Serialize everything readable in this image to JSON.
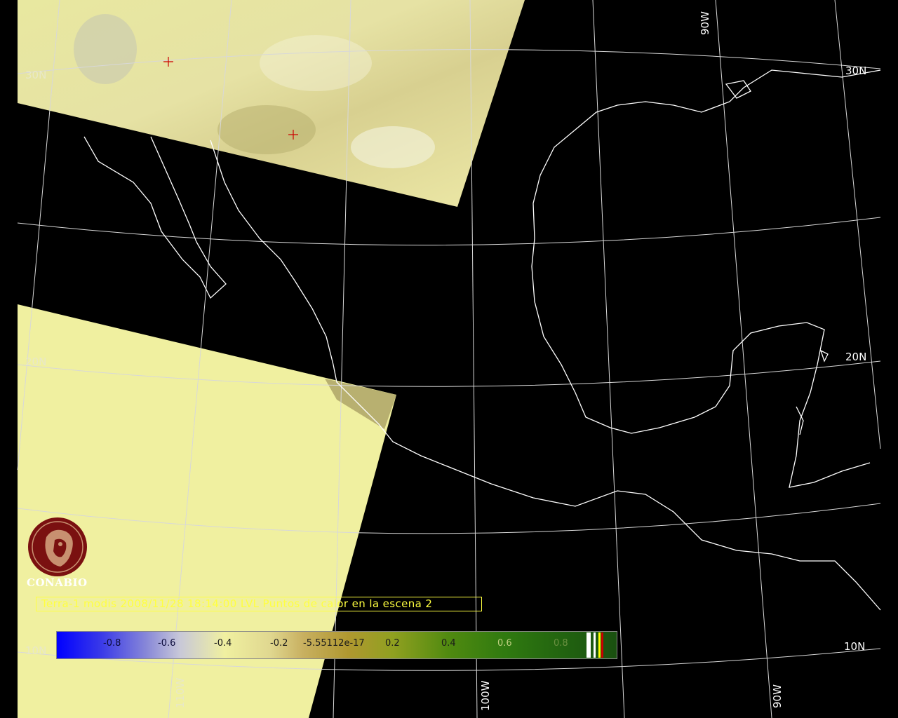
{
  "map": {
    "grid_labels": {
      "lat_30_left": "30N",
      "lat_30_right": "30N",
      "lat_20_left": "20N",
      "lat_20_right": "20N",
      "lat_10_left": "10N",
      "lat_10_right": "10N",
      "lon_90_top": "90W",
      "lon_110_bottom": "110W",
      "lon_100_bottom": "100W",
      "lon_90_bottom": "90W"
    },
    "colors": {
      "background": "#000000",
      "coastline": "#ffffff",
      "gridline": "#d8d8d8",
      "swath_fill": "#f0f0a0",
      "hotspot_marker": "#cc0000"
    }
  },
  "logo": {
    "name": "CONABIO"
  },
  "title": "Terra-1 modis 2008/11/28 18:14:00 LVL Puntos de calor en la escena 2",
  "colorbar": {
    "ticks": [
      "-0.8",
      "-0.6",
      "-0.4",
      "-0.2",
      "-5.55112e-17",
      "0.2",
      "0.4",
      "0.6",
      "0.8"
    ],
    "range": [
      -1,
      1
    ]
  }
}
